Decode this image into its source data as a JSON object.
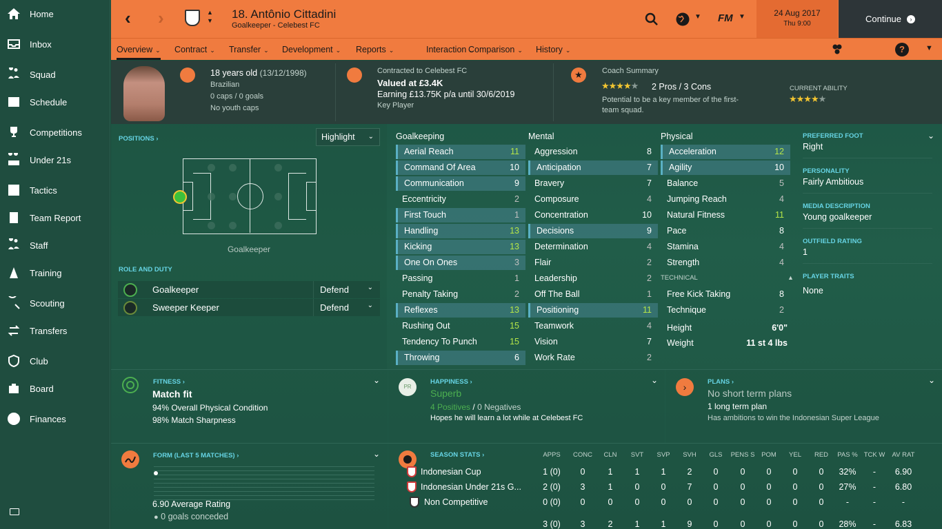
{
  "sidebar": {
    "items": [
      {
        "label": "Home",
        "icon": "home-icon"
      },
      {
        "label": "Inbox",
        "icon": "inbox-icon"
      },
      {
        "label": "Squad",
        "icon": "squad-icon"
      },
      {
        "label": "Schedule",
        "icon": "schedule-icon"
      },
      {
        "label": "Competitions",
        "icon": "trophy-icon"
      },
      {
        "label": "Under 21s",
        "icon": "under21-icon"
      },
      {
        "label": "Tactics",
        "icon": "tactics-icon"
      },
      {
        "label": "Team Report",
        "icon": "report-icon"
      },
      {
        "label": "Staff",
        "icon": "staff-icon"
      },
      {
        "label": "Training",
        "icon": "training-icon"
      },
      {
        "label": "Scouting",
        "icon": "scouting-icon"
      },
      {
        "label": "Transfers",
        "icon": "transfers-icon"
      },
      {
        "label": "Club",
        "icon": "club-icon"
      },
      {
        "label": "Board",
        "icon": "board-icon"
      },
      {
        "label": "Finances",
        "icon": "finances-icon"
      }
    ]
  },
  "header": {
    "player_name": "18. Antônio Cittadini",
    "player_sub": "Goalkeeper - Celebest FC",
    "game_logo": "FM",
    "date": "24 Aug 2017",
    "time": "Thu 9:00",
    "continue_label": "Continue"
  },
  "tabs": [
    "Overview",
    "Contract",
    "Transfer",
    "Development",
    "Reports",
    "Interaction",
    "Comparison",
    "History"
  ],
  "info": {
    "age": "18 years old",
    "dob": "(13/12/1998)",
    "nationality": "Brazilian",
    "caps": "0 caps / 0 goals",
    "youth_caps": "No youth caps",
    "contract_to": "Contracted to Celebest FC",
    "value": "Valued at £3.4K",
    "earning": "Earning £13.75K p/a until 30/6/2019",
    "status": "Key Player",
    "coach_title": "Coach Summary",
    "pros_cons": "2 Pros / 3 Cons",
    "potential": "Potential to be a key member of the first-team squad.",
    "current_ability_label": "CURRENT ABILITY",
    "potential_stars": 4,
    "current_stars": 4
  },
  "positions": {
    "title": "POSITIONS ›",
    "highlight": "Highlight",
    "position_label": "Goalkeeper",
    "role_title": "ROLE AND DUTY",
    "roles": [
      {
        "name": "Goalkeeper",
        "duty": "Defend"
      },
      {
        "name": "Sweeper Keeper",
        "duty": "Defend"
      }
    ]
  },
  "attributes": {
    "goalkeeping_title": "Goalkeeping",
    "mental_title": "Mental",
    "physical_title": "Physical",
    "technical_title": "TECHNICAL",
    "goalkeeping": [
      {
        "n": "Aerial Reach",
        "v": "11"
      },
      {
        "n": "Command Of Area",
        "v": "10"
      },
      {
        "n": "Communication",
        "v": "9"
      },
      {
        "n": "Eccentricity",
        "v": "2"
      },
      {
        "n": "First Touch",
        "v": "1"
      },
      {
        "n": "Handling",
        "v": "13"
      },
      {
        "n": "Kicking",
        "v": "13"
      },
      {
        "n": "One On Ones",
        "v": "3"
      },
      {
        "n": "Passing",
        "v": "1"
      },
      {
        "n": "Penalty Taking",
        "v": "2"
      },
      {
        "n": "Reflexes",
        "v": "13"
      },
      {
        "n": "Rushing Out",
        "v": "15"
      },
      {
        "n": "Tendency To Punch",
        "v": "15"
      },
      {
        "n": "Throwing",
        "v": "6"
      }
    ],
    "mental": [
      {
        "n": "Aggression",
        "v": "8"
      },
      {
        "n": "Anticipation",
        "v": "7"
      },
      {
        "n": "Bravery",
        "v": "7"
      },
      {
        "n": "Composure",
        "v": "4"
      },
      {
        "n": "Concentration",
        "v": "10"
      },
      {
        "n": "Decisions",
        "v": "9"
      },
      {
        "n": "Determination",
        "v": "4"
      },
      {
        "n": "Flair",
        "v": "2"
      },
      {
        "n": "Leadership",
        "v": "2"
      },
      {
        "n": "Off The Ball",
        "v": "1"
      },
      {
        "n": "Positioning",
        "v": "11"
      },
      {
        "n": "Teamwork",
        "v": "4"
      },
      {
        "n": "Vision",
        "v": "7"
      },
      {
        "n": "Work Rate",
        "v": "2"
      }
    ],
    "physical": [
      {
        "n": "Acceleration",
        "v": "12"
      },
      {
        "n": "Agility",
        "v": "10"
      },
      {
        "n": "Balance",
        "v": "5"
      },
      {
        "n": "Jumping Reach",
        "v": "4"
      },
      {
        "n": "Natural Fitness",
        "v": "11"
      },
      {
        "n": "Pace",
        "v": "8"
      },
      {
        "n": "Stamina",
        "v": "4"
      },
      {
        "n": "Strength",
        "v": "4"
      }
    ],
    "technical": [
      {
        "n": "Free Kick Taking",
        "v": "8"
      },
      {
        "n": "Technique",
        "v": "2"
      }
    ],
    "height_label": "Height",
    "height": "6'0\"",
    "weight_label": "Weight",
    "weight": "11 st 4 lbs"
  },
  "right_panel": {
    "foot_label": "PREFERRED FOOT",
    "foot": "Right",
    "personality_label": "PERSONALITY",
    "personality": "Fairly Ambitious",
    "media_label": "MEDIA DESCRIPTION",
    "media": "Young goalkeeper",
    "outfield_label": "OUTFIELD RATING",
    "outfield": "1",
    "traits_label": "PLAYER TRAITS",
    "traits": "None"
  },
  "fitness": {
    "title": "FITNESS ›",
    "status": "Match fit",
    "condition": "94% Overall Physical Condition",
    "sharpness": "98% Match Sharpness"
  },
  "happiness": {
    "title": "HAPPINESS ›",
    "badge": "PR",
    "status": "Superb",
    "positives": "4 Positives",
    "sep": "/",
    "negatives": "0 Negatives",
    "note": "Hopes he will learn a lot while at Celebest FC"
  },
  "plans": {
    "title": "PLANS ›",
    "short": "No short term plans",
    "long": "1 long term plan",
    "note": "Has ambitions to win the Indonesian Super League"
  },
  "form": {
    "title": "FORM (LAST 5 MATCHES) ›",
    "rating": "6.90 Average Rating",
    "conceded": "0 goals conceded"
  },
  "season": {
    "title": "SEASON STATS ›",
    "headers": [
      "APPS",
      "CONC",
      "CLN",
      "SVT",
      "SVP",
      "SVH",
      "GLS",
      "PENS S",
      "POM",
      "YEL",
      "RED",
      "PAS %",
      "TCK W",
      "AV RAT"
    ],
    "rows": [
      {
        "name": "Indonesian Cup",
        "vals": [
          "1 (0)",
          "0",
          "1",
          "1",
          "1",
          "2",
          "0",
          "0",
          "0",
          "0",
          "0",
          "32%",
          "-",
          "6.90"
        ]
      },
      {
        "name": "Indonesian Under 21s G...",
        "vals": [
          "2 (0)",
          "3",
          "1",
          "0",
          "0",
          "7",
          "0",
          "0",
          "0",
          "0",
          "0",
          "27%",
          "-",
          "6.80"
        ]
      },
      {
        "name": "Non Competitive",
        "vals": [
          "0 (0)",
          "0",
          "0",
          "0",
          "0",
          "0",
          "0",
          "0",
          "0",
          "0",
          "0",
          "-",
          "-",
          "-"
        ]
      }
    ],
    "totals": [
      "3 (0)",
      "3",
      "2",
      "1",
      "1",
      "9",
      "0",
      "0",
      "0",
      "0",
      "0",
      "28%",
      "-",
      "6.83"
    ]
  },
  "colors": {
    "accent": "#f07b3f",
    "panel": "#215d49",
    "sidebar": "#1f4d3f",
    "highlight": "#b5e548"
  }
}
